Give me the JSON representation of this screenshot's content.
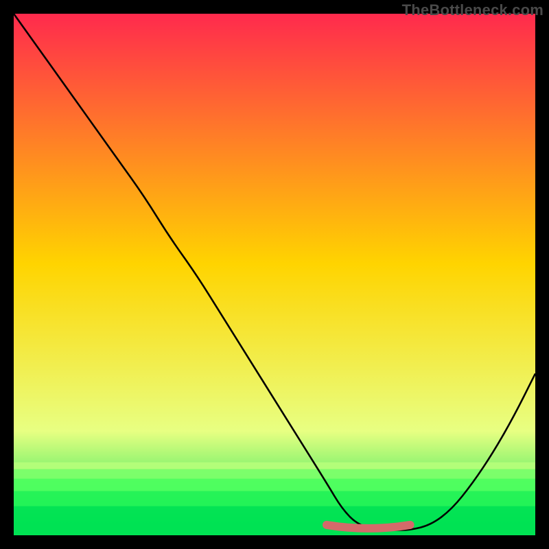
{
  "watermark": "TheBottleneck.com",
  "chart_data": {
    "type": "line",
    "title": "",
    "xlabel": "",
    "ylabel": "",
    "xlim": [
      0,
      100
    ],
    "ylim": [
      0,
      100
    ],
    "x": [
      0,
      5,
      10,
      15,
      20,
      25,
      30,
      35,
      40,
      45,
      50,
      55,
      60,
      63,
      66,
      70,
      73,
      76,
      80,
      84,
      88,
      92,
      96,
      100
    ],
    "values": [
      100,
      93,
      86,
      79,
      72,
      65,
      57,
      50,
      42,
      34,
      26,
      18,
      10,
      5,
      2,
      1,
      1,
      1,
      2,
      5,
      10,
      16,
      23,
      31
    ],
    "marker": {
      "x_range": [
        60,
        76
      ],
      "y": 1.2
    },
    "grid": false,
    "legend": null
  },
  "colors": {
    "gradient_top": "#ff2a4d",
    "gradient_mid": "#ffd400",
    "gradient_low": "#e8ff82",
    "gradient_bottom": "#00e253",
    "curve": "#000000",
    "marker": "#d46a6a",
    "frame": "#000000"
  }
}
